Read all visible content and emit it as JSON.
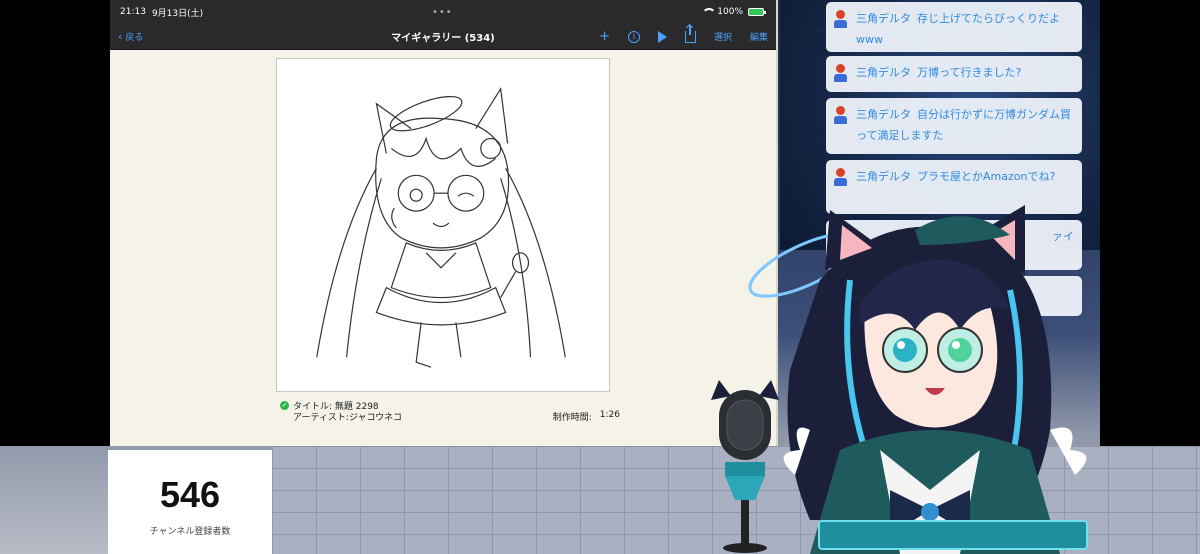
{
  "ipad": {
    "status": {
      "time": "21:13",
      "date": "9月13日(土)",
      "dots": "•••",
      "battery_label": "100%"
    },
    "nav": {
      "back_label": "戻る",
      "title": "マイギャラリー (534)",
      "add_label": "+",
      "select_label": "選択",
      "edit_label": "編集"
    },
    "artwork": {
      "title_line": "タイトル: 無題 2298",
      "artist_line": "アーティスト:ジャコウネコ",
      "duration_label": "制作時間:",
      "duration_value": "1:26"
    }
  },
  "subscribers": {
    "count": "546",
    "label": "チャンネル登録者数"
  },
  "chat": {
    "messages": [
      {
        "name": "三角デルタ",
        "text": "存じ上げてたらびっくりだよwww"
      },
      {
        "name": "三角デルタ",
        "text": "万博って行きました?"
      },
      {
        "name": "三角デルタ",
        "text": "自分は行かずに万博ガンダム買って満足しますた"
      },
      {
        "name": "三角デルタ",
        "text": "プラモ屋とかAmazonでね?"
      },
      {
        "name": "",
        "text": "ァイ"
      }
    ]
  },
  "colors": {
    "accent_blue": "#4aa3ff",
    "chat_text": "#2e8be0",
    "check_green": "#2fb34b",
    "battery_green": "#34c759"
  },
  "icons": [
    "chevron-left-icon",
    "plus-icon",
    "info-icon",
    "play-icon",
    "share-icon",
    "check-icon",
    "wifi-icon",
    "battery-icon"
  ]
}
